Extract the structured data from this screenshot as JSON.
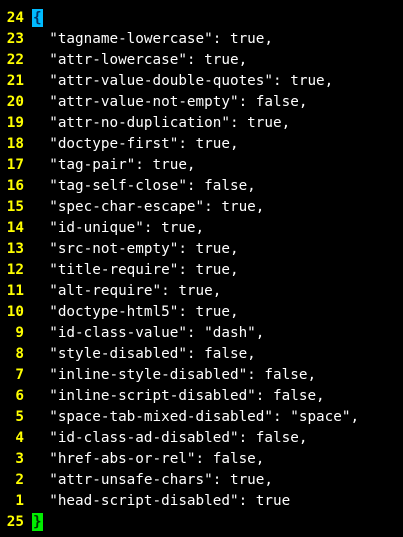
{
  "editor": {
    "lines": [
      {
        "num": "24",
        "text": "{"
      },
      {
        "num": "23",
        "text": "  \"tagname-lowercase\": true,"
      },
      {
        "num": "22",
        "text": "  \"attr-lowercase\": true,"
      },
      {
        "num": "21",
        "text": "  \"attr-value-double-quotes\": true,"
      },
      {
        "num": "20",
        "text": "  \"attr-value-not-empty\": false,"
      },
      {
        "num": "19",
        "text": "  \"attr-no-duplication\": true,"
      },
      {
        "num": "18",
        "text": "  \"doctype-first\": true,"
      },
      {
        "num": "17",
        "text": "  \"tag-pair\": true,"
      },
      {
        "num": "16",
        "text": "  \"tag-self-close\": false,"
      },
      {
        "num": "15",
        "text": "  \"spec-char-escape\": true,"
      },
      {
        "num": "14",
        "text": "  \"id-unique\": true,"
      },
      {
        "num": "13",
        "text": "  \"src-not-empty\": true,"
      },
      {
        "num": "12",
        "text": "  \"title-require\": true,"
      },
      {
        "num": "11",
        "text": "  \"alt-require\": true,"
      },
      {
        "num": "10",
        "text": "  \"doctype-html5\": true,"
      },
      {
        "num": "9",
        "text": "  \"id-class-value\": \"dash\","
      },
      {
        "num": "8",
        "text": "  \"style-disabled\": false,"
      },
      {
        "num": "7",
        "text": "  \"inline-style-disabled\": false,"
      },
      {
        "num": "6",
        "text": "  \"inline-script-disabled\": false,"
      },
      {
        "num": "5",
        "text": "  \"space-tab-mixed-disabled\": \"space\","
      },
      {
        "num": "4",
        "text": "  \"id-class-ad-disabled\": false,"
      },
      {
        "num": "3",
        "text": "  \"href-abs-or-rel\": false,"
      },
      {
        "num": "2",
        "text": "  \"attr-unsafe-chars\": true,"
      },
      {
        "num": "1",
        "text": "  \"head-script-disabled\": true"
      },
      {
        "num": "25",
        "text": "}"
      }
    ]
  },
  "colors": {
    "background": "#000000",
    "line_number": "#ffff00",
    "text": "#ffffff",
    "open_brace_highlight": "#00bbff",
    "close_brace_highlight": "#00ee00"
  }
}
